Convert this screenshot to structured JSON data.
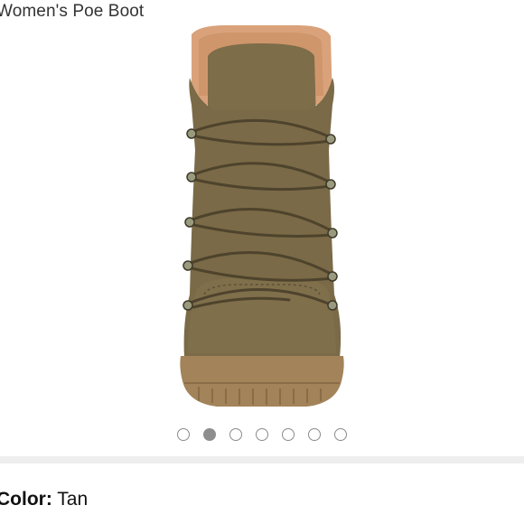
{
  "product": {
    "title": "Women's Poe Boot"
  },
  "gallery": {
    "image_count": 7,
    "active_index": 1,
    "image_icon": "boot-image"
  },
  "color": {
    "label": "Color:",
    "value": "Tan"
  },
  "colors": {
    "suede": "#7a6a47",
    "sole": "#a2835a",
    "lining": "#d9a27a",
    "dot_active": "#8e8e8e"
  }
}
